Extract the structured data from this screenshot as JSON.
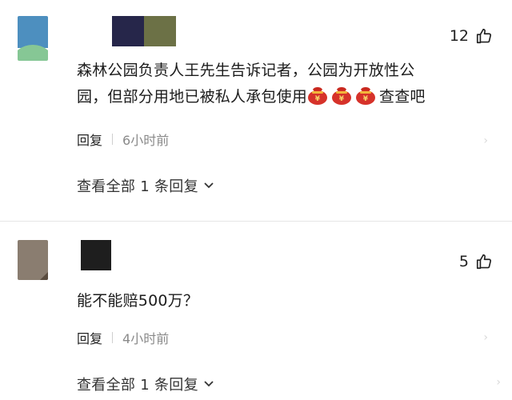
{
  "comments": [
    {
      "likes": "12",
      "text_line1": "森林公园负责人王先生告诉记者，公园为开放性公",
      "text_line2_before": "园，但部分用地已被私人承包使用",
      "text_line2_after": "查查吧",
      "emoji_count": 3,
      "reply_label": "回复",
      "time": "6小时前",
      "view_replies": "查看全部 1 条回复"
    },
    {
      "likes": "5",
      "text": "能不能赔500万？",
      "reply_label": "回复",
      "time": "4小时前",
      "view_replies": "查看全部 1 条回复"
    }
  ],
  "icons": {
    "like": "thumbs-up-icon",
    "expand": "chevron-down-icon",
    "emoji": "money-bag-emoji"
  },
  "colors": {
    "avatar1_blue": "#4d8fbf",
    "avatar1_green": "#7dc28a",
    "name1_block_a": "#26264a",
    "name1_block_b": "#6c7146",
    "avatar2": "#8a7d70",
    "name2_block": "#1e1e1e",
    "time_gray": "#8a8a8a",
    "emoji_red": "#d6322a",
    "emoji_gold": "#f2b53a"
  }
}
